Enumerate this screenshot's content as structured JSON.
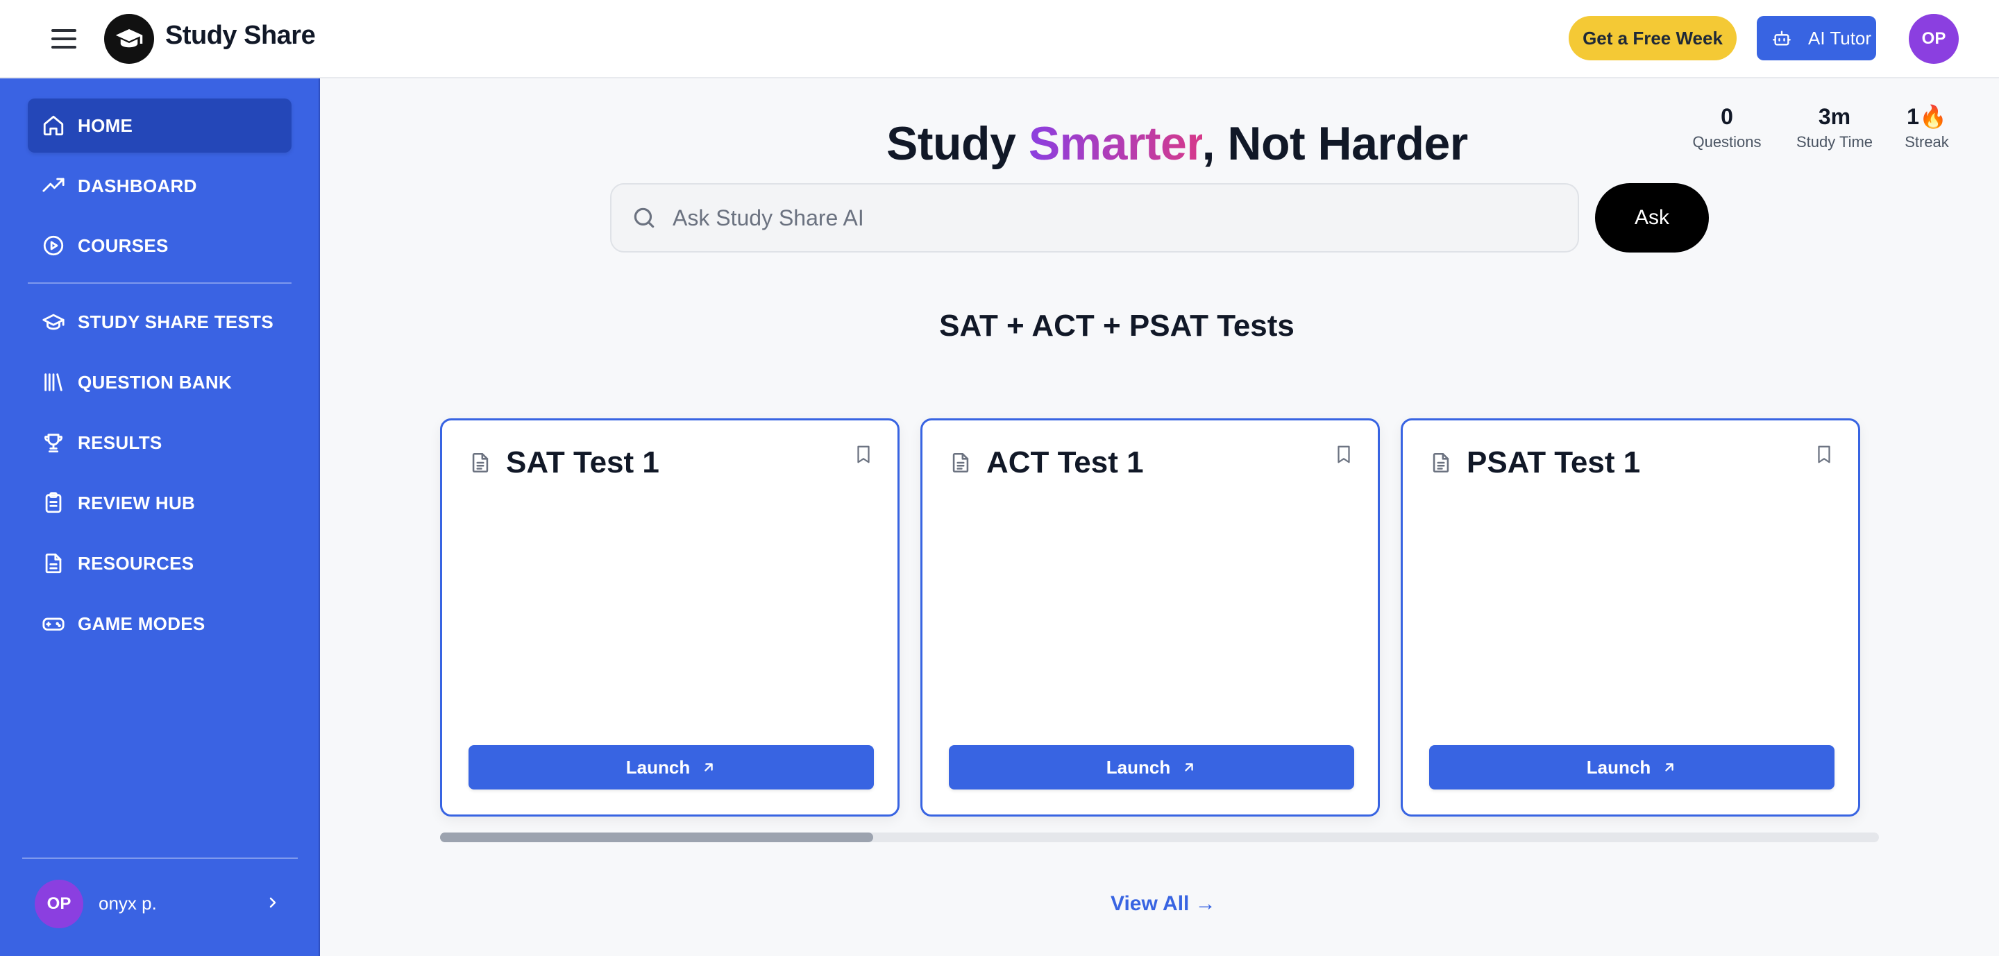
{
  "header": {
    "brand": "Study Share",
    "free_week_label": "Get a Free Week",
    "ai_tutor_label": "AI Tutor",
    "avatar_initials": "OP"
  },
  "sidebar": {
    "items": [
      {
        "label": "HOME",
        "icon": "home-icon",
        "active": true
      },
      {
        "label": "DASHBOARD",
        "icon": "trending-up-icon"
      },
      {
        "label": "COURSES",
        "icon": "play-circle-icon"
      },
      {
        "label": "STUDY SHARE TESTS",
        "icon": "graduation-cap-icon"
      },
      {
        "label": "QUESTION BANK",
        "icon": "library-icon"
      },
      {
        "label": "RESULTS",
        "icon": "trophy-icon"
      },
      {
        "label": "REVIEW HUB",
        "icon": "clipboard-icon"
      },
      {
        "label": "RESOURCES",
        "icon": "document-icon"
      },
      {
        "label": "GAME MODES",
        "icon": "gamepad-icon"
      }
    ],
    "user": {
      "initials": "OP",
      "name": "onyx p."
    }
  },
  "stats": [
    {
      "value": "0",
      "label": "Questions"
    },
    {
      "value": "3m",
      "label": "Study Time"
    },
    {
      "value": "1🔥",
      "label": "Streak"
    }
  ],
  "hero": {
    "word1": "Study",
    "word2": "Smarter",
    "word3": ", Not Harder"
  },
  "search": {
    "placeholder": "Ask Study Share AI",
    "value": "",
    "ask_label": "Ask"
  },
  "tests": {
    "section_title": "SAT + ACT + PSAT Tests",
    "cards": [
      {
        "title": "SAT Test 1",
        "launch_label": "Launch"
      },
      {
        "title": "ACT Test 1",
        "launch_label": "Launch"
      },
      {
        "title": "PSAT Test 1",
        "launch_label": "Launch"
      }
    ],
    "view_all_label": "View All →"
  },
  "colors": {
    "primary": "#3864e2",
    "sidebar": "#3a63e3",
    "sidebar_active": "#2447b8",
    "accent_yellow": "#f4c935",
    "avatar_purple": "#8b3fe0",
    "gradient_start": "#8b3fe0",
    "gradient_end": "#d63a8a"
  }
}
